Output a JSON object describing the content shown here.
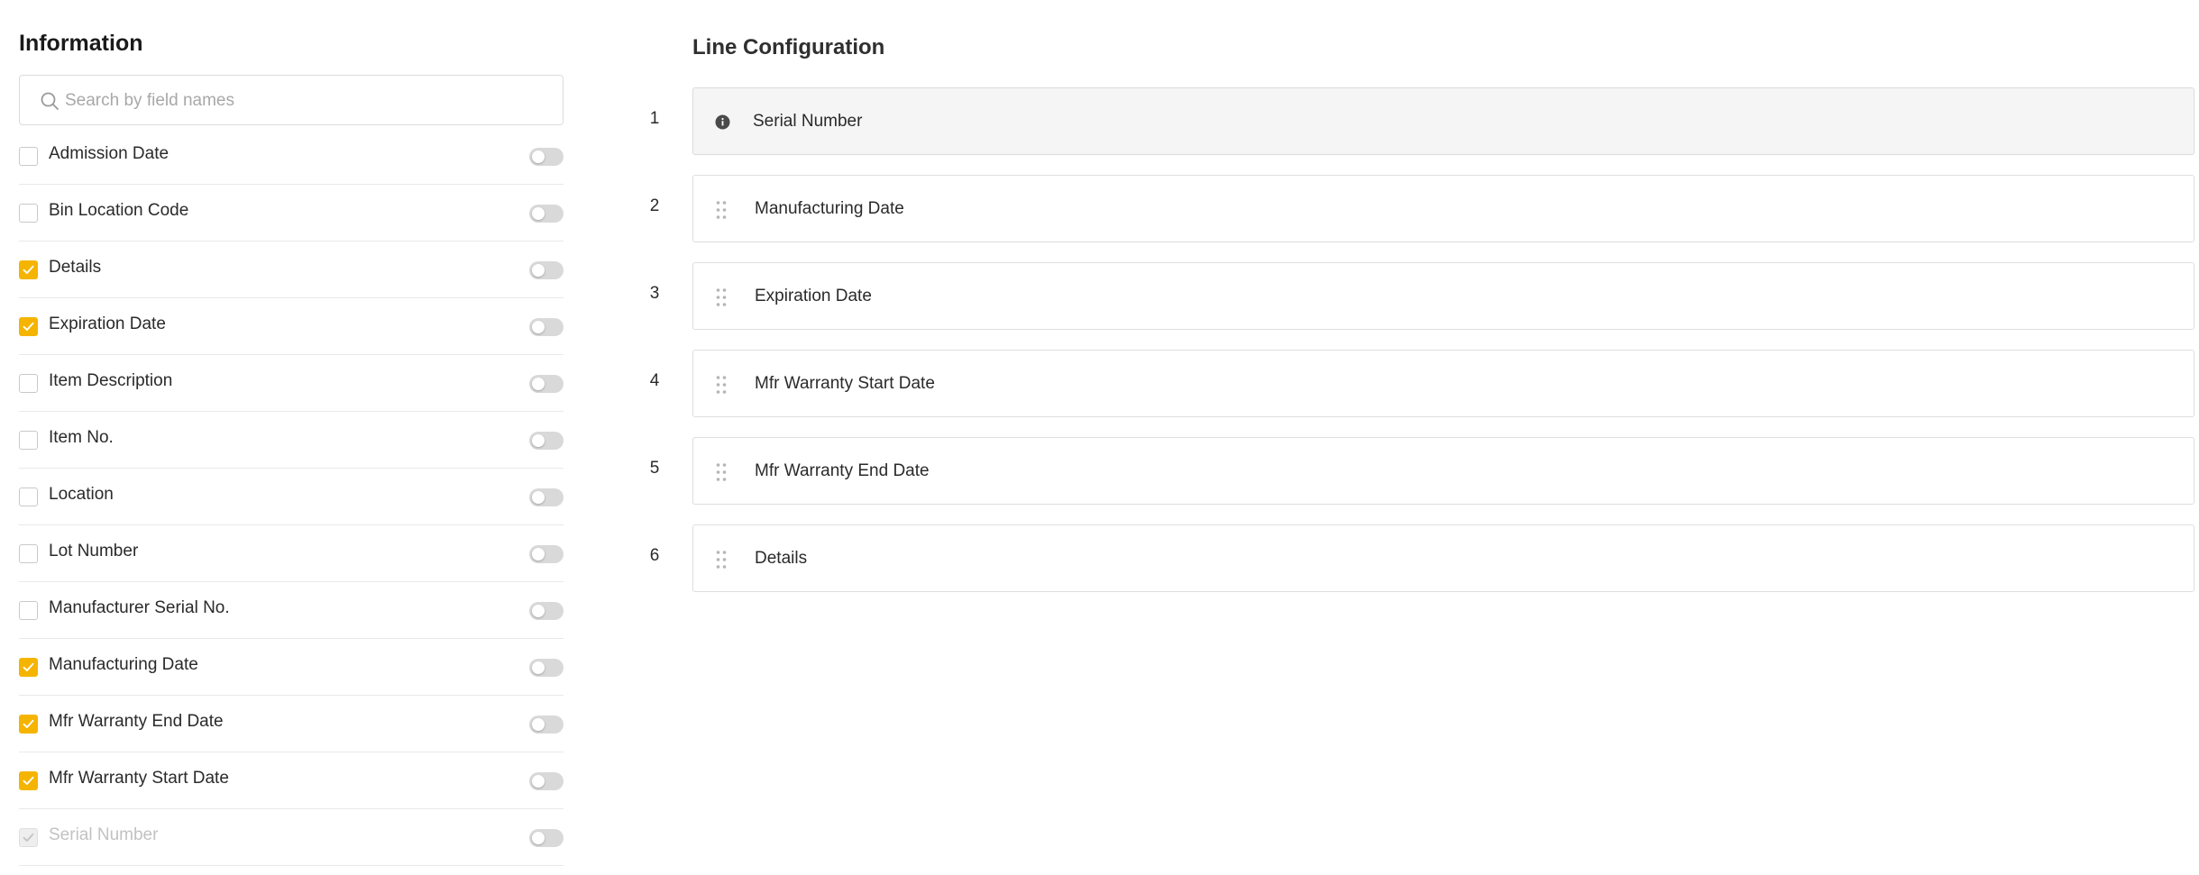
{
  "left_panel": {
    "title": "Information",
    "search": {
      "placeholder": "Search by field names",
      "value": ""
    },
    "fields": [
      {
        "label": "Admission Date",
        "checked": false,
        "disabled": false,
        "toggle_on": false
      },
      {
        "label": "Bin Location Code",
        "checked": false,
        "disabled": false,
        "toggle_on": false
      },
      {
        "label": "Details",
        "checked": true,
        "disabled": false,
        "toggle_on": false
      },
      {
        "label": "Expiration Date",
        "checked": true,
        "disabled": false,
        "toggle_on": false
      },
      {
        "label": "Item Description",
        "checked": false,
        "disabled": false,
        "toggle_on": false
      },
      {
        "label": "Item No.",
        "checked": false,
        "disabled": false,
        "toggle_on": false
      },
      {
        "label": "Location",
        "checked": false,
        "disabled": false,
        "toggle_on": false
      },
      {
        "label": "Lot Number",
        "checked": false,
        "disabled": false,
        "toggle_on": false
      },
      {
        "label": "Manufacturer Serial No.",
        "checked": false,
        "disabled": false,
        "toggle_on": false
      },
      {
        "label": "Manufacturing Date",
        "checked": true,
        "disabled": false,
        "toggle_on": false
      },
      {
        "label": "Mfr Warranty End Date",
        "checked": true,
        "disabled": false,
        "toggle_on": false
      },
      {
        "label": "Mfr Warranty Start Date",
        "checked": true,
        "disabled": false,
        "toggle_on": false
      },
      {
        "label": "Serial Number",
        "checked": true,
        "disabled": true,
        "toggle_on": false
      }
    ]
  },
  "right_panel": {
    "title": "Line Configuration",
    "rows": [
      {
        "number": "1",
        "label": "Serial Number",
        "locked": true,
        "icon": "info-icon"
      },
      {
        "number": "2",
        "label": "Manufacturing Date",
        "locked": false,
        "icon": "drag-handle-icon"
      },
      {
        "number": "3",
        "label": "Expiration Date",
        "locked": false,
        "icon": "drag-handle-icon"
      },
      {
        "number": "4",
        "label": "Mfr Warranty Start Date",
        "locked": false,
        "icon": "drag-handle-icon"
      },
      {
        "number": "5",
        "label": "Mfr Warranty End Date",
        "locked": false,
        "icon": "drag-handle-icon"
      },
      {
        "number": "6",
        "label": "Details",
        "locked": false,
        "icon": "drag-handle-icon"
      }
    ]
  },
  "colors": {
    "accent": "#f5b400",
    "toggle_off": "#d9d9d9",
    "border": "#dedede",
    "locked_row_bg": "#f5f5f5",
    "disabled_text": "#c2c2c2"
  }
}
